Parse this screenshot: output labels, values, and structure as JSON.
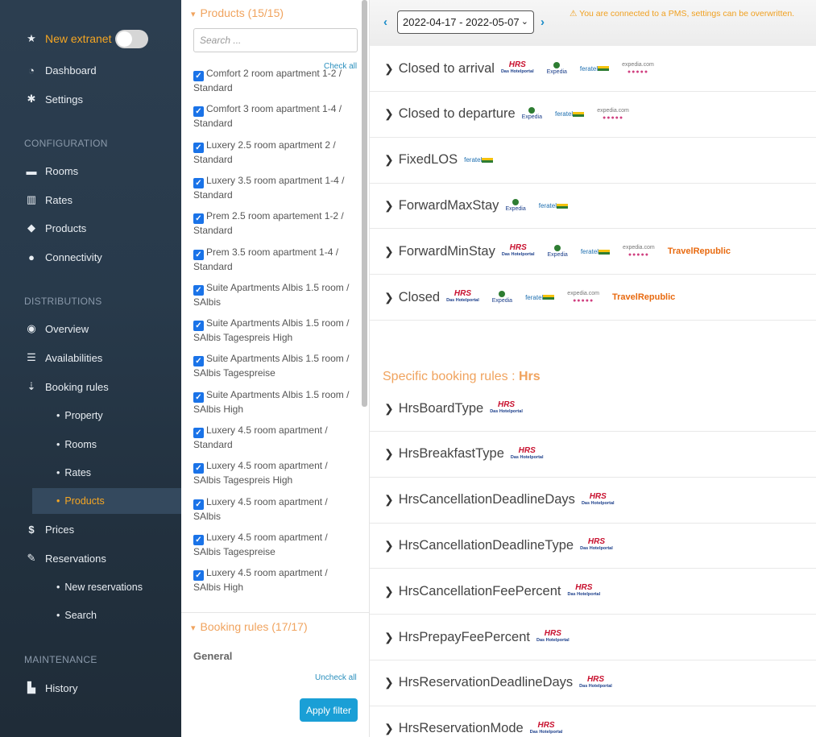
{
  "sidebar": {
    "new_extranet": "New extranet",
    "dashboard": "Dashboard",
    "settings": "Settings",
    "section_configuration": "CONFIGURATION",
    "rooms": "Rooms",
    "rates": "Rates",
    "products": "Products",
    "connectivity": "Connectivity",
    "section_distributions": "DISTRIBUTIONS",
    "overview": "Overview",
    "availabilities": "Availabilities",
    "booking_rules": "Booking rules",
    "sub_property": "Property",
    "sub_rooms": "Rooms",
    "sub_rates": "Rates",
    "sub_products": "Products",
    "prices": "Prices",
    "reservations": "Reservations",
    "sub_new_reservations": "New reservations",
    "sub_search": "Search",
    "section_maintenance": "MAINTENANCE",
    "history": "History"
  },
  "filter": {
    "products_title": "Products (15/15)",
    "search_placeholder": "Search ...",
    "check_all": "Check all",
    "products": [
      "Comfort 2 room apartment 1-2 / Standard",
      "Comfort 3 room apartment 1-4 / Standard",
      "Luxery 2.5 room apartment 2 / Standard",
      "Luxery 3.5 room apartment 1-4 / Standard",
      "Prem 2.5 room apartement 1-2 / Standard",
      "Prem 3.5 room apartment 1-4 / Standard",
      "Suite Apartments Albis 1.5 room / SAlbis",
      "Suite Apartments Albis 1.5 room / SAlbis Tagespreis High",
      "Suite Apartments Albis 1.5 room / SAlbis Tagespreise",
      "Suite Apartments Albis 1.5 room / SAlbis High",
      "Luxery 4.5 room apartment / Standard",
      "Luxery 4.5 room apartment / SAlbis Tagespreis High",
      "Luxery 4.5 room apartment / SAlbis",
      "Luxery 4.5 room apartment / SAlbis Tagespreise",
      "Luxery 4.5 room apartment / SAlbis High"
    ],
    "booking_rules_title": "Booking rules (17/17)",
    "general": "General",
    "uncheck_all": "Uncheck all",
    "apply": "Apply filter"
  },
  "main": {
    "date_range": "2022-04-17 - 2022-05-07",
    "warning": "You are connected to a PMS, settings can be overwritten.",
    "rules": [
      {
        "name": "Closed to arrival",
        "logos": [
          "hrs",
          "expedia",
          "feratel",
          "expedia-com"
        ]
      },
      {
        "name": "Closed to departure",
        "logos": [
          "expedia",
          "feratel",
          "expedia-com"
        ]
      },
      {
        "name": "FixedLOS",
        "logos": [
          "feratel"
        ]
      },
      {
        "name": "ForwardMaxStay",
        "logos": [
          "expedia",
          "feratel"
        ]
      },
      {
        "name": "ForwardMinStay",
        "logos": [
          "hrs",
          "expedia",
          "feratel",
          "expedia-com",
          "travelrepublic"
        ]
      },
      {
        "name": "Closed",
        "logos": [
          "hrs",
          "expedia",
          "feratel",
          "expedia-com",
          "travelrepublic"
        ]
      }
    ],
    "specific_label": "Specific booking rules :",
    "specific_channel": "Hrs",
    "hrs_rules": [
      "HrsBoardType",
      "HrsBreakfastType",
      "HrsCancellationDeadlineDays",
      "HrsCancellationDeadlineType",
      "HrsCancellationFeePercent",
      "HrsPrepayFeePercent",
      "HrsReservationDeadlineDays",
      "HrsReservationMode"
    ]
  },
  "logo_text": {
    "hrs": "HRS",
    "hrs_sub": "Das Hotelportal",
    "expedia": "Expedia",
    "feratel": "feratel",
    "expedia_com": "expedia.com",
    "travel": "Travel",
    "republic": "Republic"
  }
}
